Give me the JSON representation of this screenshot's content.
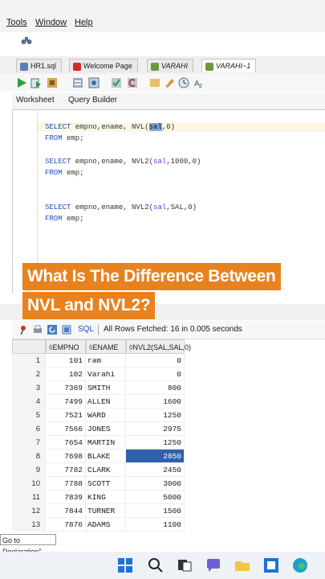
{
  "menu": {
    "items": [
      "Tools",
      "Window",
      "Help"
    ]
  },
  "editor_tabs": [
    {
      "label": "HR1.sql",
      "icon": "sql-file-icon",
      "color": "#5a7fb5"
    },
    {
      "label": "Welcome Page",
      "icon": "oracle-icon",
      "color": "#d22a2a"
    },
    {
      "label": "VARAHI",
      "icon": "db-connection-icon",
      "color": "#6a9a3a"
    },
    {
      "label": "VARAHI~1",
      "icon": "db-connection-icon",
      "color": "#6a9a3a"
    }
  ],
  "subtabs": {
    "worksheet": "Worksheet",
    "query_builder": "Query Builder"
  },
  "code": {
    "q1_select": "SELECT",
    "q1_cols": " empno,ename, ",
    "q1_fn": "NVL(",
    "q1_arg_hl": "sal",
    "q1_rest": ",0)",
    "q1_from": "FROM",
    "q1_table": " emp;",
    "q2_select": "SELECT",
    "q2_cols": " empno,ename, ",
    "q2_fn": "NVL2(",
    "q2_arg": "sal",
    "q2_rest": ",1000,0)",
    "q2_from": "FROM",
    "q2_table": " emp;",
    "q3_select": "SELECT",
    "q3_cols": " empno,ename, ",
    "q3_fn": "NVL2(",
    "q3_arg": "sal",
    "q3_rest": ",SAL,0)",
    "q3_from": "FROM",
    "q3_table": " emp;"
  },
  "caption": {
    "line1": "What Is The Difference Between",
    "line2": "NVL and NVL2?"
  },
  "results": {
    "close_glyph": "x",
    "sql_label": "SQL",
    "status": "All Rows Fetched: 16 in 0.005 seconds",
    "columns": [
      "EMPNO",
      "ENAME",
      "NVL2(SAL,SAL,0)"
    ],
    "rows": [
      {
        "n": "1",
        "empno": "101",
        "ename": "ram",
        "nvl": "0"
      },
      {
        "n": "2",
        "empno": "102",
        "ename": "Varahi",
        "nvl": "0"
      },
      {
        "n": "3",
        "empno": "7369",
        "ename": "SMITH",
        "nvl": "800"
      },
      {
        "n": "4",
        "empno": "7499",
        "ename": "ALLEN",
        "nvl": "1600"
      },
      {
        "n": "5",
        "empno": "7521",
        "ename": "WARD",
        "nvl": "1250"
      },
      {
        "n": "6",
        "empno": "7566",
        "ename": "JONES",
        "nvl": "2975"
      },
      {
        "n": "7",
        "empno": "7654",
        "ename": "MARTIN",
        "nvl": "1250"
      },
      {
        "n": "8",
        "empno": "7698",
        "ename": "BLAKE",
        "nvl": "2850"
      },
      {
        "n": "9",
        "empno": "7782",
        "ename": "CLARK",
        "nvl": "2450"
      },
      {
        "n": "10",
        "empno": "7788",
        "ename": "SCOTT",
        "nvl": "3000"
      },
      {
        "n": "11",
        "empno": "7839",
        "ename": "KING",
        "nvl": "5000"
      },
      {
        "n": "12",
        "empno": "7844",
        "ename": "TURNER",
        "nvl": "1500"
      },
      {
        "n": "13",
        "empno": "7876",
        "ename": "ADAMS",
        "nvl": "1100"
      }
    ]
  },
  "bottom": {
    "declaration": "Go to Declaration\""
  },
  "colors": {
    "accent_caption": "#e8821f",
    "selection": "#2f62a8",
    "keyword": "#1f4fbf"
  }
}
